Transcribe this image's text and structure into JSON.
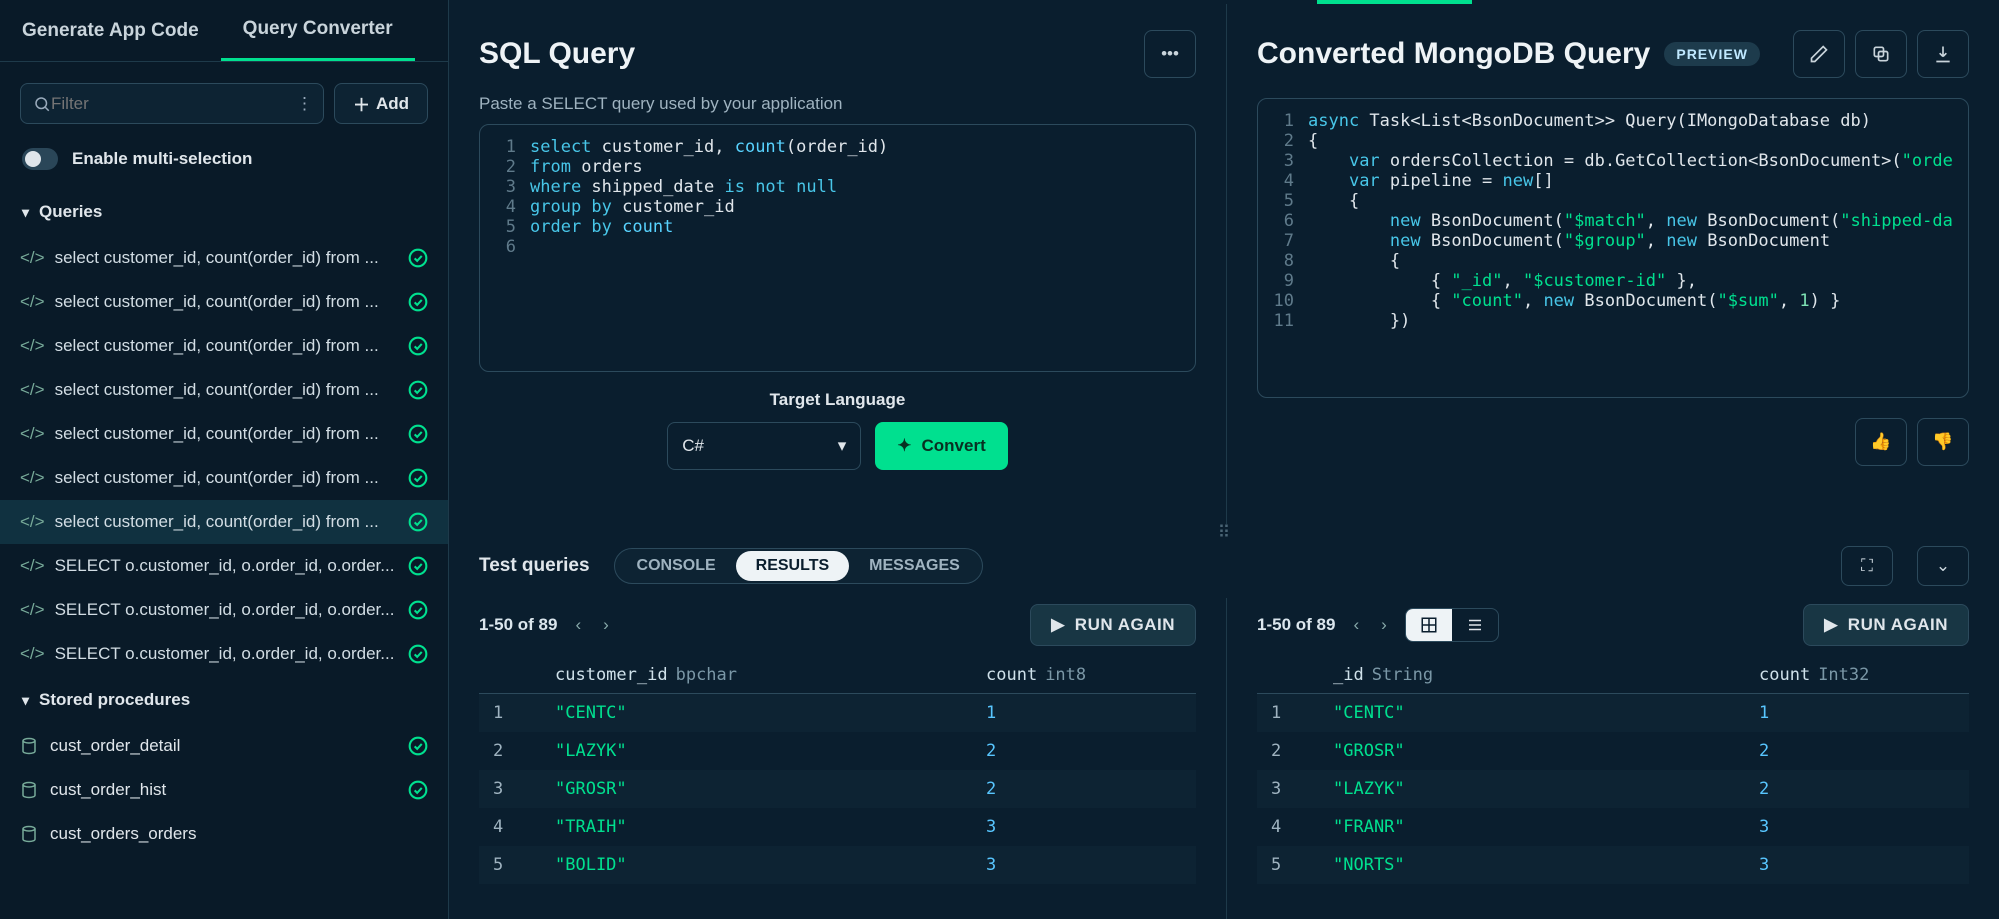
{
  "tabs": {
    "generate": "Generate App Code",
    "convert": "Query Converter"
  },
  "sidebar": {
    "filter_placeholder": "Filter",
    "add_label": "Add",
    "toggle_label": "Enable multi-selection",
    "queries_header": "Queries",
    "query_items": [
      "select customer_id, count(order_id) from ...",
      "select customer_id, count(order_id) from ...",
      "select customer_id, count(order_id) from ...",
      "select customer_id, count(order_id) from ...",
      "select customer_id, count(order_id) from ...",
      "select customer_id, count(order_id) from ...",
      "select customer_id, count(order_id) from ...",
      "SELECT o.customer_id, o.order_id, o.order...",
      "SELECT o.customer_id, o.order_id, o.order...",
      "SELECT o.customer_id, o.order_id, o.order..."
    ],
    "selected_index": 6,
    "sp_header": "Stored procedures",
    "sp_items": [
      {
        "label": "cust_order_detail",
        "checked": true
      },
      {
        "label": "cust_order_hist",
        "checked": true
      },
      {
        "label": "cust_orders_orders",
        "checked": false
      }
    ]
  },
  "sql_panel": {
    "title": "SQL Query",
    "hint": "Paste a SELECT query used by your application",
    "lines": [
      [
        [
          "kw",
          "select"
        ],
        [
          "id",
          " customer_id, "
        ],
        [
          "fn",
          "count"
        ],
        [
          "id",
          "(order_id)"
        ]
      ],
      [
        [
          "kw",
          "from"
        ],
        [
          "id",
          " orders"
        ]
      ],
      [
        [
          "kw",
          "where"
        ],
        [
          "id",
          " shipped_date "
        ],
        [
          "kw",
          "is not null"
        ]
      ],
      [
        [
          "kw",
          "group by"
        ],
        [
          "id",
          " customer_id"
        ]
      ],
      [
        [
          "kw",
          "order by"
        ],
        [
          "id",
          " "
        ],
        [
          "fn",
          "count"
        ]
      ],
      [
        [
          "id",
          ""
        ]
      ]
    ],
    "target_label": "Target Language",
    "target_value": "C#",
    "convert_label": "Convert"
  },
  "mongo_panel": {
    "title": "Converted MongoDB Query",
    "badge": "PREVIEW",
    "lines": [
      [
        [
          "kw",
          "async"
        ],
        [
          "id",
          " Task<List<BsonDocument>> Query(IMongoDatabase db)"
        ]
      ],
      [
        [
          "id",
          "{"
        ]
      ],
      [
        [
          "id",
          "    "
        ],
        [
          "kw",
          "var"
        ],
        [
          "id",
          " ordersCollection = db.GetCollection<BsonDocument>("
        ],
        [
          "str",
          "\"orde"
        ]
      ],
      [
        [
          "id",
          "    "
        ],
        [
          "kw",
          "var"
        ],
        [
          "id",
          " pipeline = "
        ],
        [
          "kw",
          "new"
        ],
        [
          "id",
          "[]"
        ]
      ],
      [
        [
          "id",
          "    {"
        ]
      ],
      [
        [
          "id",
          "        "
        ],
        [
          "kw",
          "new"
        ],
        [
          "id",
          " BsonDocument("
        ],
        [
          "str",
          "\"$match\""
        ],
        [
          "id",
          ", "
        ],
        [
          "kw",
          "new"
        ],
        [
          "id",
          " BsonDocument("
        ],
        [
          "str",
          "\"shipped-da"
        ]
      ],
      [
        [
          "id",
          "        "
        ],
        [
          "kw",
          "new"
        ],
        [
          "id",
          " BsonDocument("
        ],
        [
          "str",
          "\"$group\""
        ],
        [
          "id",
          ", "
        ],
        [
          "kw",
          "new"
        ],
        [
          "id",
          " BsonDocument"
        ]
      ],
      [
        [
          "id",
          "        {"
        ]
      ],
      [
        [
          "id",
          "            { "
        ],
        [
          "str",
          "\"_id\""
        ],
        [
          "id",
          ", "
        ],
        [
          "str",
          "\"$customer-id\""
        ],
        [
          "id",
          " },"
        ]
      ],
      [
        [
          "id",
          "            { "
        ],
        [
          "str",
          "\"count\""
        ],
        [
          "id",
          ", "
        ],
        [
          "kw",
          "new"
        ],
        [
          "id",
          " BsonDocument("
        ],
        [
          "str",
          "\"$sum\""
        ],
        [
          "id",
          ", "
        ],
        [
          "num",
          "1"
        ],
        [
          "id",
          ") }"
        ]
      ],
      [
        [
          "id",
          "        })"
        ]
      ]
    ]
  },
  "results": {
    "test_label": "Test queries",
    "tabs": {
      "console": "CONSOLE",
      "results": "RESULTS",
      "messages": "MESSAGES"
    },
    "pager": "1-50 of 89",
    "run_label": "RUN AGAIN",
    "left": {
      "cols": [
        {
          "name": "customer_id",
          "type": "bpchar"
        },
        {
          "name": "count",
          "type": "int8"
        }
      ],
      "rows": [
        [
          "\"CENTC\"",
          "1"
        ],
        [
          "\"LAZYK\"",
          "2"
        ],
        [
          "\"GROSR\"",
          "2"
        ],
        [
          "\"TRAIH\"",
          "3"
        ],
        [
          "\"BOLID\"",
          "3"
        ]
      ]
    },
    "right": {
      "cols": [
        {
          "name": "_id",
          "type": "String"
        },
        {
          "name": "count",
          "type": "Int32"
        }
      ],
      "rows": [
        [
          "\"CENTC\"",
          "1"
        ],
        [
          "\"GROSR\"",
          "2"
        ],
        [
          "\"LAZYK\"",
          "2"
        ],
        [
          "\"FRANR\"",
          "3"
        ],
        [
          "\"NORTS\"",
          "3"
        ]
      ]
    }
  }
}
